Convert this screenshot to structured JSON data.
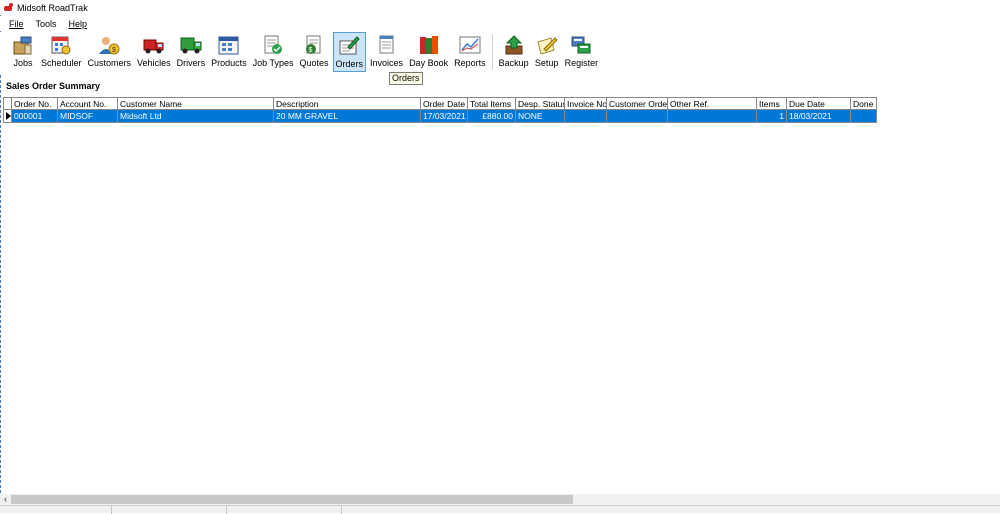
{
  "window": {
    "title": "Midsoft RoadTrak"
  },
  "menu": [
    {
      "label": "File",
      "name": "menu-file"
    },
    {
      "label": "Tools",
      "name": "menu-tools"
    },
    {
      "label": "Help",
      "name": "menu-help"
    }
  ],
  "toolbar": {
    "buttons": [
      {
        "label": "Jobs",
        "icon": "jobs-icon"
      },
      {
        "label": "Scheduler",
        "icon": "scheduler-icon"
      },
      {
        "label": "Customers",
        "icon": "customers-icon"
      },
      {
        "label": "Vehicles",
        "icon": "vehicles-icon"
      },
      {
        "label": "Drivers",
        "icon": "drivers-icon"
      },
      {
        "label": "Products",
        "icon": "products-icon"
      },
      {
        "label": "Job Types",
        "icon": "job-types-icon"
      },
      {
        "label": "Quotes",
        "icon": "quotes-icon"
      },
      {
        "label": "Orders",
        "icon": "orders-icon"
      },
      {
        "label": "Invoices",
        "icon": "invoices-icon"
      },
      {
        "label": "Day Book",
        "icon": "day-book-icon"
      },
      {
        "label": "Reports",
        "icon": "reports-icon"
      },
      {
        "label": "Backup",
        "icon": "backup-icon"
      },
      {
        "label": "Setup",
        "icon": "setup-icon"
      },
      {
        "label": "Register",
        "icon": "register-icon"
      }
    ],
    "active": "Orders",
    "tooltip": "Orders"
  },
  "section": {
    "title": "Sales Order Summary"
  },
  "grid": {
    "columns": [
      "Order No.",
      "Account No.",
      "Customer Name",
      "Description",
      "Order Date",
      "Total Items",
      "Desp. Status",
      "Invoice No",
      "Customer Order",
      "Other Ref.",
      "Items",
      "Due Date",
      "Done"
    ],
    "rows": [
      [
        "000001",
        "MIDSOF",
        "Midsoft Ltd",
        "20 MM GRAVEL",
        "17/03/2021",
        "£880.00",
        "NONE",
        "",
        "",
        "",
        "1",
        "18/03/2021",
        ""
      ]
    ]
  },
  "colors": {
    "selection": "#0078d7",
    "active_button": "#cce4f7"
  }
}
